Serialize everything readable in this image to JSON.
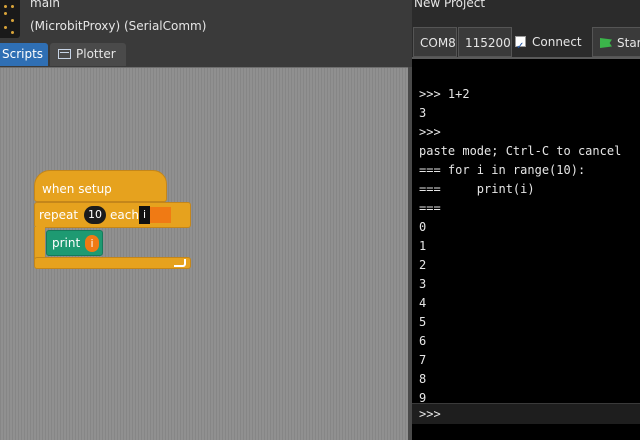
{
  "sprite": {
    "name": "main",
    "libraries": "(MicrobitProxy) (SerialComm)"
  },
  "tabs": [
    {
      "label": "Scripts",
      "active": true
    },
    {
      "label": "Plotter",
      "active": false
    }
  ],
  "blocks": {
    "hat": "when setup",
    "repeat_label": "repeat",
    "repeat_count": "10",
    "each_label": "each",
    "loop_var": "i",
    "print_label": "print",
    "print_arg": "i"
  },
  "project": {
    "title": "New Project"
  },
  "toolbar": {
    "port": "COM8",
    "baud": "115200",
    "connect_label": "Connect",
    "connect_checked": true,
    "start_label": "Start"
  },
  "console": {
    "lines": [
      ">>> 1+2",
      "3",
      ">>>",
      "paste mode; Ctrl-C to cancel",
      "=== for i in range(10):",
      "===     print(i)",
      "===",
      "0",
      "1",
      "2",
      "3",
      "4",
      "5",
      "6",
      "7",
      "8",
      "9"
    ],
    "prompt": ">>>"
  },
  "colors": {
    "control_block": "#e6a21e",
    "output_block": "#1e9a72",
    "variable": "#f07a14",
    "active_tab": "#2f6fb4",
    "console_bg": "#000000"
  }
}
